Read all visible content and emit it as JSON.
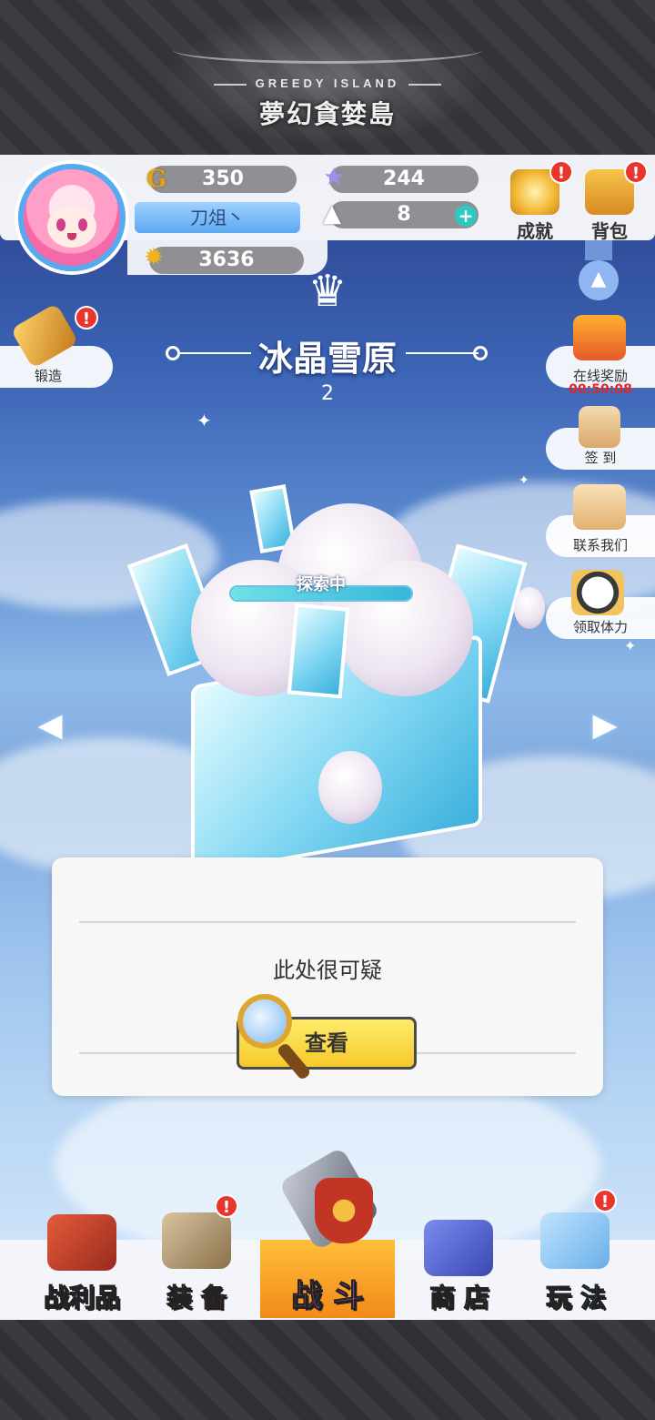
{
  "logo": {
    "en": "GREEDY ISLAND",
    "cn": "夢幻貪婪島"
  },
  "player": {
    "gold": "350",
    "stars": "244",
    "name": "刀俎丶",
    "stamina": "8",
    "power": "3636"
  },
  "top_buttons": [
    {
      "label": "成就",
      "badge": "!"
    },
    {
      "label": "背包",
      "badge": "!"
    }
  ],
  "left_buttons": [
    {
      "label": "锻造",
      "badge": "!"
    }
  ],
  "right_buttons": [
    {
      "label": "在线奖励",
      "timer": "00:50:08"
    },
    {
      "label": "签 到"
    },
    {
      "label": "联系我们"
    },
    {
      "label": "领取体力"
    }
  ],
  "stage": {
    "title": "冰晶雪原",
    "number": "2",
    "status": "探索中",
    "progress": 1.0
  },
  "dialog": {
    "text": "此处很可疑",
    "button": "查看"
  },
  "bottom_nav": [
    {
      "label": "战利品",
      "color": "#3a7fd6"
    },
    {
      "label": "装 备",
      "color": "#e5322d",
      "badge": "!"
    },
    {
      "label": "战 斗",
      "color": "#d85bd8",
      "active": true
    },
    {
      "label": "商 店",
      "color": "#2e9e4a"
    },
    {
      "label": "玩 法",
      "color": "#2a9ed8",
      "badge": "!"
    }
  ],
  "colors": {
    "accent": "#57a9f0",
    "badge": "#e8362f",
    "button": "#f6c92b",
    "timer": "#e0262a"
  }
}
